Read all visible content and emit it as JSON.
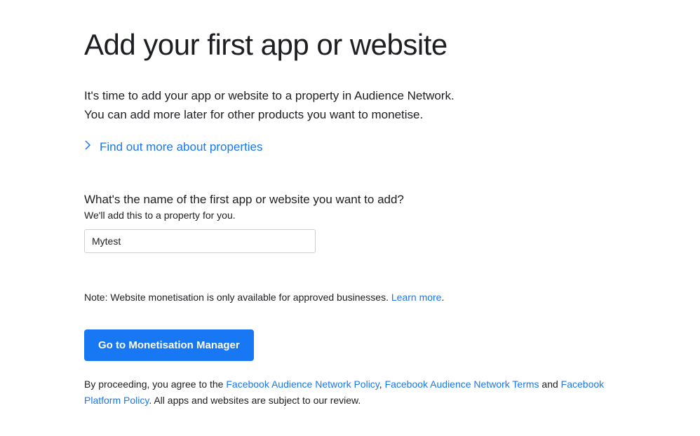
{
  "title": "Add your first app or website",
  "intro_line1": "It's time to add your app or website to a property in Audience Network.",
  "intro_line2": "You can add more later for other products you want to monetise.",
  "expand_link": "Find out more about properties",
  "form": {
    "question": "What's the name of the first app or website you want to add?",
    "sub": "We'll add this to a property for you.",
    "value": "Mytest"
  },
  "note": {
    "prefix": "Note: Website monetisation is only available for approved businesses. ",
    "link": "Learn more",
    "suffix": "."
  },
  "button_label": "Go to Monetisation Manager",
  "agreement": {
    "prefix": "By proceeding, you agree to the ",
    "link1": "Facebook Audience Network Policy",
    "sep1": ", ",
    "link2": "Facebook Audience Network Terms",
    "sep2": " and ",
    "link3": "Facebook Platform Policy",
    "suffix": ". All apps and websites are subject to our review."
  }
}
